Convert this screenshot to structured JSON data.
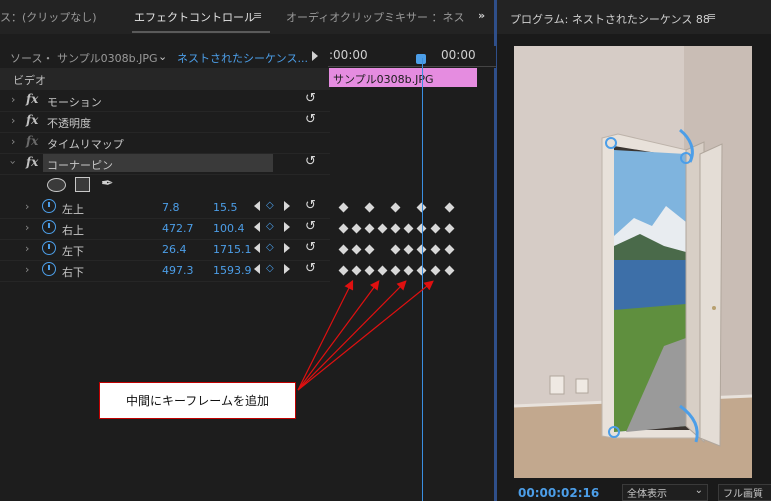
{
  "tabs": {
    "source": "ス：(クリップなし)",
    "effect_controls": "エフェクトコントロール",
    "audio_mixer": "オーディオクリップミキサー ：ネス",
    "program": "プログラム: ネストされたシーケンス 88"
  },
  "effect_panel": {
    "source_label": "ソース・ サンプル0308b.JPG",
    "sequence_label": "ネストされたシーケンス...",
    "video_header": "ビデオ",
    "effects": [
      {
        "label": "モーション"
      },
      {
        "label": "不透明度"
      },
      {
        "label": "タイムリマップ"
      },
      {
        "label": "コーナーピン"
      }
    ],
    "params": [
      {
        "label": "左上",
        "x": "7.8",
        "y": "15.5"
      },
      {
        "label": "右上",
        "x": "472.7",
        "y": "100.4"
      },
      {
        "label": "左下",
        "x": "26.4",
        "y": "1715.1"
      },
      {
        "label": "右下",
        "x": "497.3",
        "y": "1593.9"
      }
    ]
  },
  "timeline": {
    "time_start": ":00:00",
    "time_end": "00:00",
    "clip_name": "サンプル0308b.JPG"
  },
  "annotation": {
    "text": "中間にキーフレームを追加"
  },
  "monitor": {
    "timecode": "00:00:02:16",
    "zoom": "全体表示",
    "quality": "フル画質"
  },
  "colors": {
    "accent": "#4c9ee8",
    "clip": "#e58ce0",
    "arrow": "#e01010"
  }
}
